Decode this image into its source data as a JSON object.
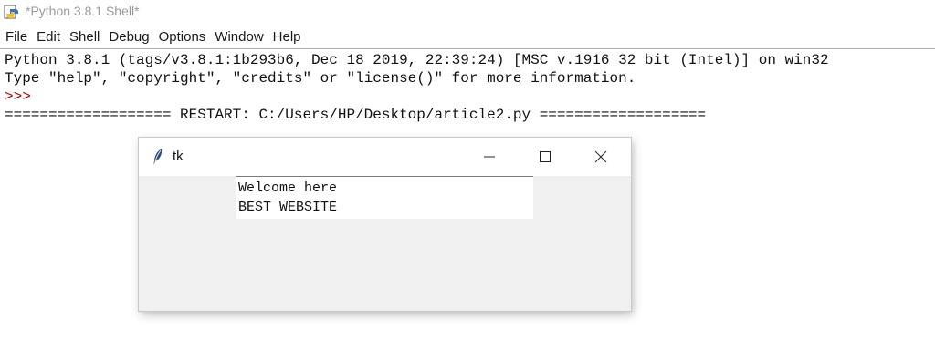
{
  "window": {
    "title": "*Python 3.8.1 Shell*",
    "icon": "python-idle-icon"
  },
  "menu": [
    "File",
    "Edit",
    "Shell",
    "Debug",
    "Options",
    "Window",
    "Help"
  ],
  "shell": {
    "line1": "Python 3.8.1 (tags/v3.8.1:1b293b6, Dec 18 2019, 22:39:24) [MSC v.1916 32 bit (Intel)] on win32",
    "line2": "Type \"help\", \"copyright\", \"credits\" or \"license()\" for more information.",
    "prompt": ">>>",
    "restart": "=================== RESTART: C:/Users/HP/Desktop/article2.py ==================="
  },
  "tk_window": {
    "title": "tk",
    "icon": "tk-feather-icon",
    "text_lines": [
      "Welcome here",
      "BEST WEBSITE"
    ]
  },
  "colors": {
    "prompt": "#c00000",
    "title_inactive": "#9a9a9a"
  }
}
